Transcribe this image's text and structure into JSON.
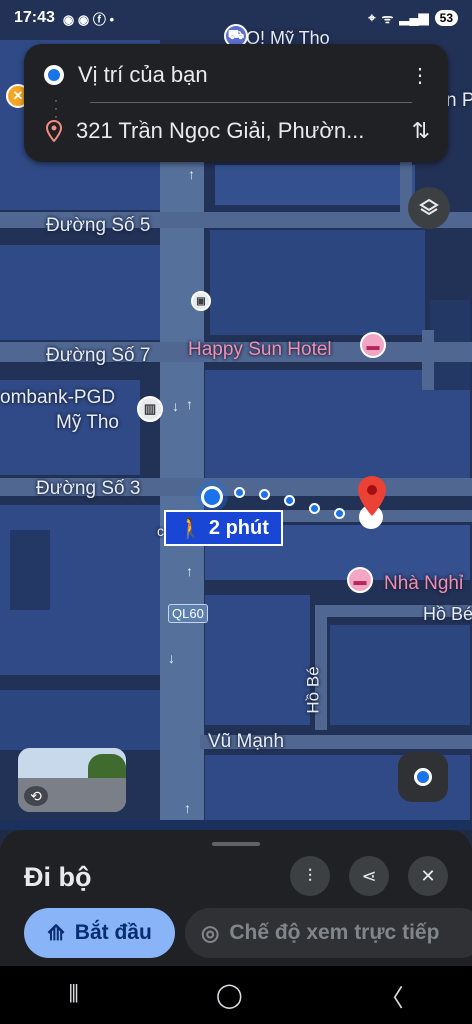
{
  "status_bar": {
    "time": "17:43",
    "left_icons": [
      "messenger-icon",
      "messenger-icon",
      "facebook-icon",
      "dot-icon"
    ],
    "battery": "53"
  },
  "route_card": {
    "origin": "Vị trí của bạn",
    "destination": "321 Trần Ngọc Giải, Phườn..."
  },
  "map": {
    "labels": {
      "go_my_tho": "GO! Mỹ Tho",
      "duong_so_5": "Đường Số 5",
      "duong_so_7": "Đường Số 7",
      "duong_so_3": "Đường Số 3",
      "happy_sun_hotel": "Happy Sun Hotel",
      "bank_line1": "ombank-PGD",
      "bank_line2": "Mỹ Tho",
      "nha_nghi": "Nhà Nghỉ",
      "ho_be_h": "Hồ Bé",
      "ho_be_v": "Hồ Bé",
      "vu_manh": "Vũ Mạnh",
      "ql60": "QL60",
      "edge_ph": "n Ph",
      "edge_c": "c"
    },
    "walk_badge": "2 phút"
  },
  "sheet": {
    "mode_title": "Đi bộ",
    "start_button": "Bắt đầu",
    "live_view_button": "Chế độ xem trực tiếp"
  },
  "colors": {
    "accent_blue": "#1a73e8",
    "start_button_bg": "#8ab4f8",
    "destination_pin": "#ea4335"
  }
}
